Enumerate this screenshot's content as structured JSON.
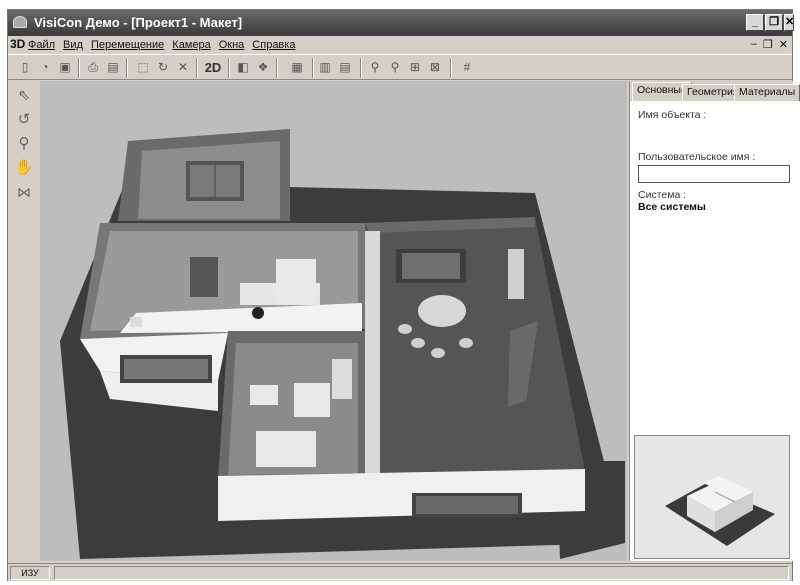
{
  "window": {
    "title": "VisiCon Демо - [Проект1 - Макет]"
  },
  "menubar": {
    "logo": "3D",
    "items": [
      "Файл",
      "Вид",
      "Перемещение",
      "Камера",
      "Окна",
      "Справка"
    ]
  },
  "toolbar": {
    "mode_2d_label": "2D"
  },
  "panel": {
    "tabs": [
      "Основные",
      "Геометрия",
      "Материалы"
    ],
    "object_name_label": "Имя объекта :",
    "user_name_label": "Пользовательское имя :",
    "user_name_value": "",
    "system_label": "Система :",
    "system_value": "Все системы"
  },
  "status": {
    "mode": "ИЗУ"
  },
  "icons": {
    "toolbar": [
      "new-file-icon",
      "open-file-icon",
      "save-icon",
      "print-icon",
      "print-preview-icon",
      "select-region-icon",
      "rotate-camera-icon",
      "delete-icon",
      "mode-2d",
      "view-3d-icon",
      "materials-icon",
      "table-icon",
      "page-icon",
      "page-export-icon",
      "zoom-in-icon",
      "zoom-out-icon",
      "zoom-region-icon",
      "zoom-fit-icon",
      "grid-icon"
    ],
    "left_tools": [
      "pointer-icon",
      "rotate-icon",
      "zoom-icon",
      "pan-hand-icon",
      "walls-icon"
    ]
  }
}
